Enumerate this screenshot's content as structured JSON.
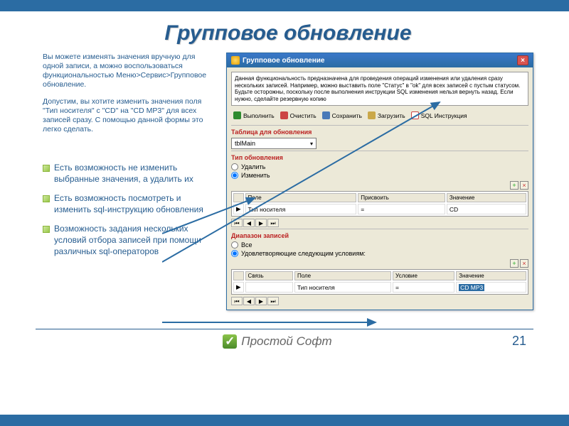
{
  "slide": {
    "title": "Групповое обновление",
    "intro1": "Вы можете изменять значения вручную для одной записи, а можно воспользоваться функциональностью Меню>Сервис>Групповое обновление.",
    "intro2": "Допустим, вы хотите изменить значения поля \"Тип носителя\" с \"CD\" на \"CD MP3\" для всех записей сразу. С помощью данной формы это легко сделать.",
    "bullets": [
      "Есть возможность не изменить выбранные значения, а удалить их",
      "Есть возможность посмотреть и изменить sql-инструкцию обновления",
      "Возможность задания нескольких условий отбора записей при помощи различных sql-операторов"
    ]
  },
  "window": {
    "title": "Групповое обновление",
    "info": "Данная функциональность предназначена для проведения операций изменения или удаления сразу нескольких записей. Например, можно выставить поле \"Статус\" в \"ok\" для всех записей с пустым статусом. Будьте осторожны, поскольку после выполнения инструкции SQL изменения нельзя вернуть назад. Если нужно, сделайте резервную копию",
    "toolbar": {
      "run": "Выполнить",
      "clear": "Очистить",
      "save": "Сохранить",
      "load": "Загрузить",
      "sql": "SQL Инструкция"
    },
    "sec_table": "Таблица для обновления",
    "table_value": "tblMain",
    "sec_type": "Тип обновления",
    "type_delete": "Удалить",
    "type_change": "Изменить",
    "grid1": {
      "h1": "Поле",
      "h2": "Присвоить",
      "h3": "Значение",
      "r1c1": "Тип носителя",
      "r1c2": "=",
      "r1c3": "CD"
    },
    "sec_range": "Диапазон записей",
    "range_all": "Все",
    "range_cond": "Удовлетворяющие следующим условиям:",
    "grid2": {
      "h0": "Связь",
      "h1": "Поле",
      "h2": "Условие",
      "h3": "Значение",
      "r1c1": "Тип носителя",
      "r1c2": "=",
      "r1c3": "CD MP3"
    }
  },
  "footer": {
    "brand": "Простой Софт",
    "page": "21"
  }
}
